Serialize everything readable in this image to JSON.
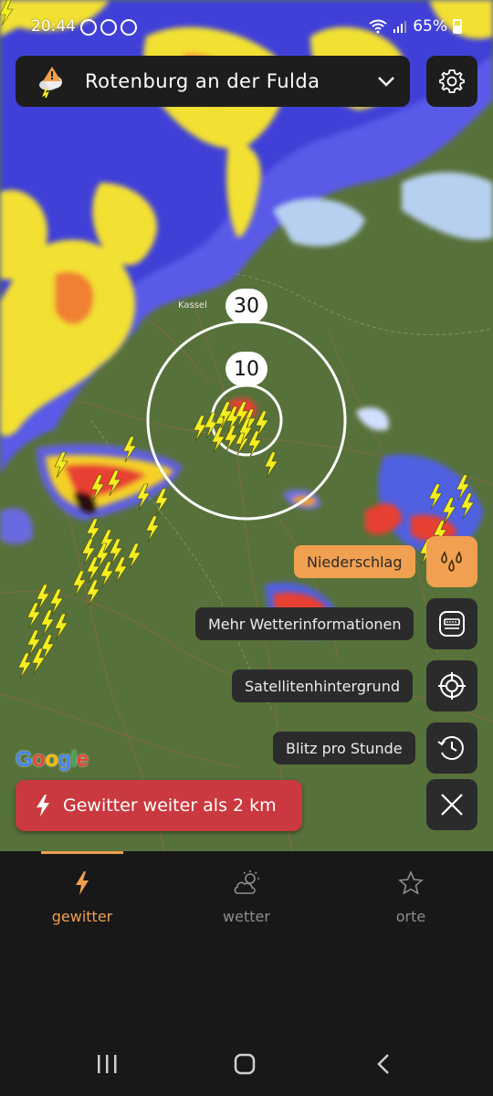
{
  "status_bar": {
    "time": "20:44",
    "battery": "65%",
    "notification_icons": [
      "whatsapp-icon",
      "whatsapp-icon",
      "messenger-icon"
    ],
    "system_icons": [
      "wifi-icon",
      "signal-icon",
      "battery-icon"
    ]
  },
  "header": {
    "location": "Rotenburg an der Fulda",
    "location_icon": "storm-warning-icon",
    "dropdown_icon": "chevron-down-icon",
    "settings_icon": "gear-icon"
  },
  "map": {
    "place_label": "Kassel",
    "range_inner": "10",
    "range_outer": "30",
    "attribution": "Google"
  },
  "layer_menu": [
    {
      "label": "Niederschlag",
      "icon": "raindrops-icon",
      "active": true
    },
    {
      "label": "Mehr Wetterinformationen",
      "icon": "dashboard-icon",
      "active": false
    },
    {
      "label": "Satellitenhintergrund",
      "icon": "crosshair-icon",
      "active": false
    },
    {
      "label": "Blitz pro Stunde",
      "icon": "clock-history-icon",
      "active": false
    }
  ],
  "close_icon": "close-icon",
  "alert": {
    "text": "Gewitter weiter als 2 km",
    "icon": "lightning-icon"
  },
  "bottom_nav": [
    {
      "label": "gewitter",
      "icon": "lightning-icon",
      "active": true
    },
    {
      "label": "wetter",
      "icon": "cloud-sun-icon",
      "active": false
    },
    {
      "label": "orte",
      "icon": "star-icon",
      "active": false
    }
  ],
  "colors": {
    "accent": "#f0a050",
    "alert": "#c9393f",
    "panel": "#1d1d1d",
    "map_land": "#57713a"
  }
}
